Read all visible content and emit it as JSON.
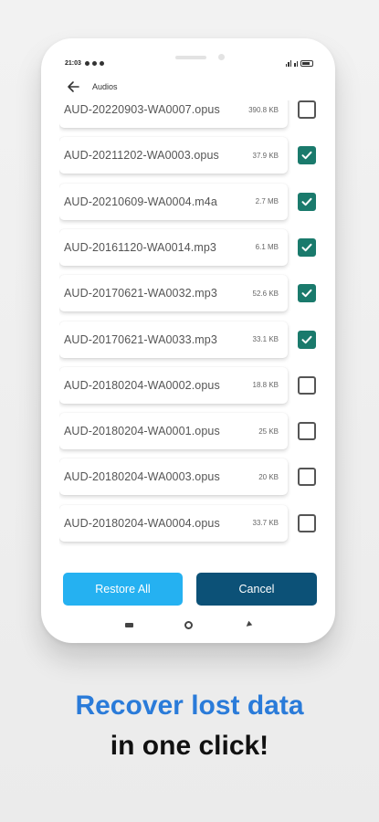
{
  "status_bar": {
    "time": "21:03",
    "battery_icon": "battery-icon"
  },
  "header": {
    "title": "Audios",
    "back_icon": "arrow-left-icon"
  },
  "files": [
    {
      "name": "AUD-20220903-WA0007.opus",
      "size": "390.8 KB",
      "checked": false
    },
    {
      "name": "AUD-20211202-WA0003.opus",
      "size": "37.9 KB",
      "checked": true
    },
    {
      "name": "AUD-20210609-WA0004.m4a",
      "size": "2.7 MB",
      "checked": true
    },
    {
      "name": "AUD-20161120-WA0014.mp3",
      "size": "6.1 MB",
      "checked": true
    },
    {
      "name": "AUD-20170621-WA0032.mp3",
      "size": "52.6 KB",
      "checked": true
    },
    {
      "name": "AUD-20170621-WA0033.mp3",
      "size": "33.1 KB",
      "checked": true
    },
    {
      "name": "AUD-20180204-WA0002.opus",
      "size": "18.8 KB",
      "checked": false
    },
    {
      "name": "AUD-20180204-WA0001.opus",
      "size": "25 KB",
      "checked": false
    },
    {
      "name": "AUD-20180204-WA0003.opus",
      "size": "20 KB",
      "checked": false
    },
    {
      "name": "AUD-20180204-WA0004.opus",
      "size": "33.7 KB",
      "checked": false
    }
  ],
  "buttons": {
    "restore_all": "Restore All",
    "cancel": "Cancel"
  },
  "tagline": {
    "line1": "Recover lost data",
    "line2": "in one click!"
  },
  "colors": {
    "check": "#1a7a6c",
    "restore": "#25b1f1",
    "cancel": "#0c5177",
    "tagline_accent": "#2a7bd9"
  }
}
